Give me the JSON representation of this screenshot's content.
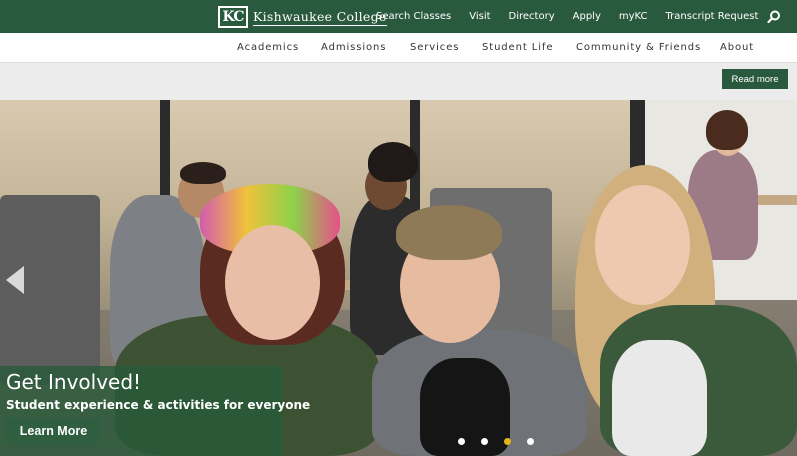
{
  "brand": {
    "logo_mark": "KC",
    "name": "Kishwaukee College"
  },
  "top_links": [
    "Search Classes",
    "Visit",
    "Directory",
    "Apply",
    "myKC",
    "Transcript Request"
  ],
  "main_nav": [
    "Academics",
    "Admissions",
    "Services",
    "Student Life",
    "Community & Friends",
    "About"
  ],
  "alert": {
    "read_more": "Read more"
  },
  "hero": {
    "title": "Get Involved!",
    "subtitle": "Student experience & activities for everyone",
    "cta": "Learn More",
    "slide_count": 4,
    "active_slide": 3
  },
  "colors": {
    "brand_green": "#2a5a3e",
    "active_dot": "#e6b619"
  }
}
